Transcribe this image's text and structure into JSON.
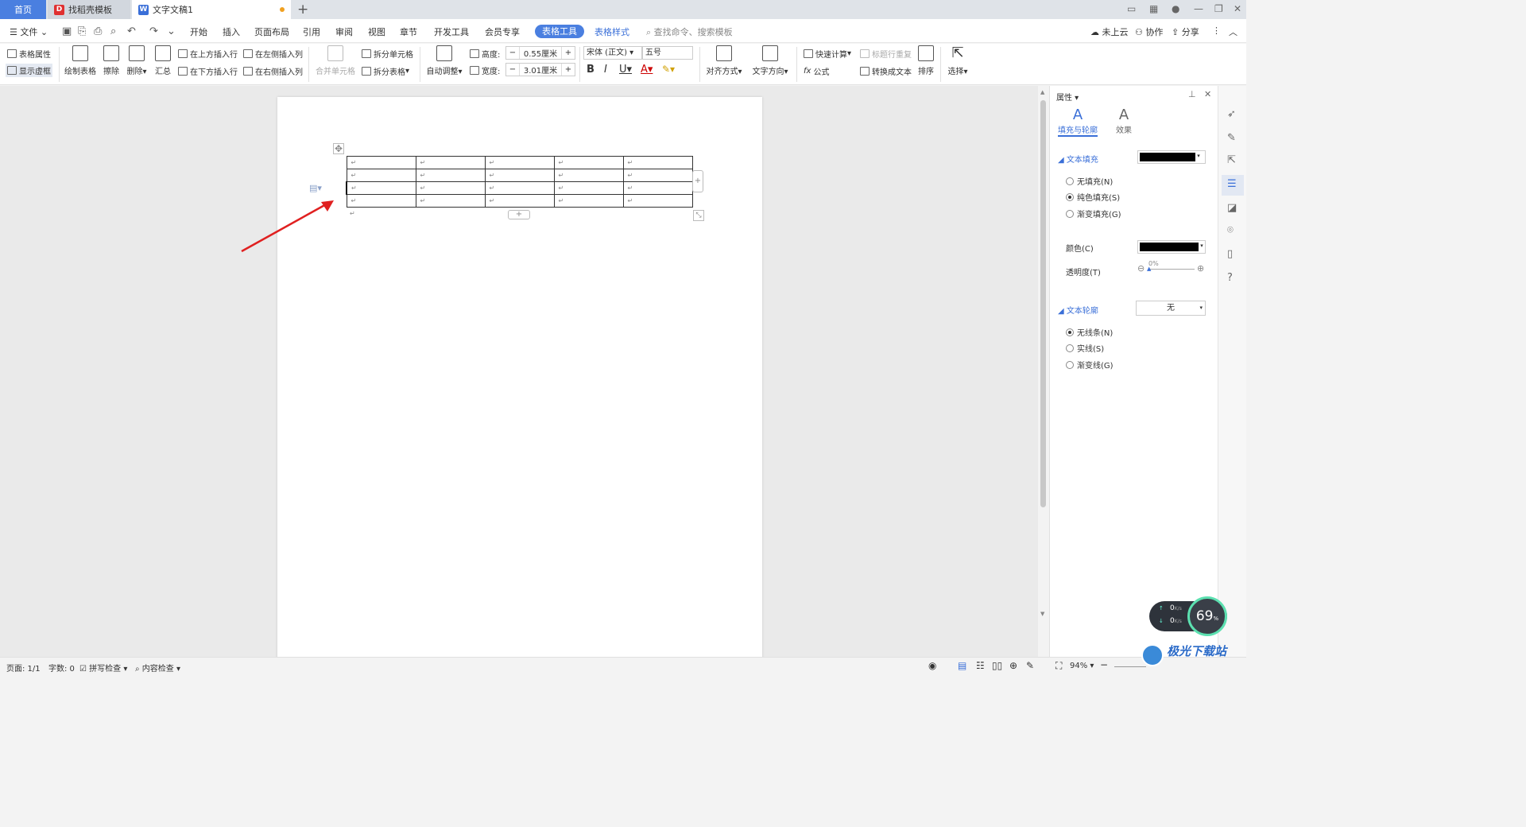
{
  "titlebar": {
    "tabs": [
      {
        "label": "首页"
      },
      {
        "label": "找稻壳模板"
      },
      {
        "label": "文字文稿1"
      }
    ],
    "new_tab_icon": "plus-icon"
  },
  "menubar": {
    "file_label": "文件",
    "items": [
      "开始",
      "插入",
      "页面布局",
      "引用",
      "审阅",
      "视图",
      "章节",
      "开发工具",
      "会员专享",
      "表格工具",
      "表格样式"
    ],
    "active": "表格工具",
    "search_placeholder": "查找命令、搜索模板",
    "right": {
      "cloud": "未上云",
      "collab": "协作",
      "share": "分享"
    }
  },
  "ribbon": {
    "table_props": "表格属性",
    "show_gridlines": "显示虚框",
    "draw_table": "绘制表格",
    "erase": "擦除",
    "delete": "删除",
    "summary": "汇总",
    "insert_above": "在上方插入行",
    "insert_below": "在下方插入行",
    "insert_left": "在左侧插入列",
    "insert_right": "在右侧插入列",
    "merge_cells": "合并单元格",
    "split_cells": "拆分单元格",
    "split_table": "拆分表格",
    "auto_fit": "自动调整",
    "height_label": "高度:",
    "height_value": "0.55厘米",
    "width_label": "宽度:",
    "width_value": "3.01厘米",
    "font_name": "宋体 (正文)",
    "font_size": "五号",
    "align": "对齐方式",
    "text_dir": "文字方向",
    "quick_calc": "快速计算",
    "repeat_header": "标题行重复",
    "formula": "公式",
    "to_text": "转换成文本",
    "sort": "排序",
    "select": "选择"
  },
  "document": {
    "table": {
      "rows": 4,
      "cols": 5,
      "cell_mark": "↵"
    },
    "after_mark": "↵"
  },
  "panel": {
    "title": "属性",
    "tabs": [
      "填充与轮廓",
      "效果"
    ],
    "text_fill_title": "文本填充",
    "fill_options": [
      {
        "label": "无填充(N)",
        "checked": false
      },
      {
        "label": "纯色填充(S)",
        "checked": true
      },
      {
        "label": "渐变填充(G)",
        "checked": false
      }
    ],
    "color_label": "颜色(C)",
    "color_value": "#000000",
    "transparency_label": "透明度(T)",
    "transparency_value": "0%",
    "outline_title": "文本轮廓",
    "outline_value": "无",
    "outline_options": [
      {
        "label": "无线条(N)",
        "checked": true
      },
      {
        "label": "实线(S)",
        "checked": false
      },
      {
        "label": "渐变线(G)",
        "checked": false
      }
    ]
  },
  "statusbar": {
    "page": "页面: 1/1",
    "words": "字数: 0",
    "spell": "拼写检查",
    "content": "内容检查",
    "zoom": "94%"
  },
  "overlay": {
    "net_up": "0",
    "net_down": "0",
    "net_unit": "K/s",
    "cpu": "69",
    "cpu_unit": "%",
    "watermark": "极光下载站"
  },
  "colors": {
    "accent": "#4a7fe0",
    "arrow": "#e02020"
  }
}
